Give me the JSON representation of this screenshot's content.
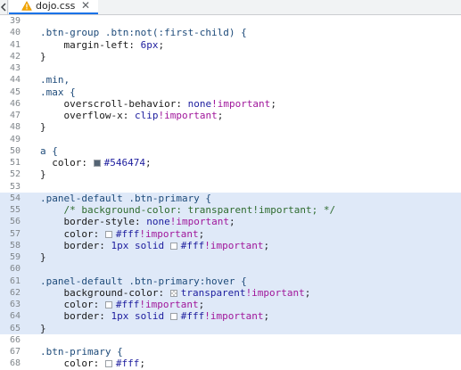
{
  "tab": {
    "file_name": "dojo.css",
    "close_glyph": "✕",
    "warning_icon": "warning-icon"
  },
  "colors": {
    "accent": "#1a73e8",
    "highlight": "#dfe9f8",
    "selector": "#1e4b7a",
    "value": "#1d1d9e",
    "important": "#a0179b",
    "comment": "#2e6b2e"
  },
  "lines": [
    {
      "n": "39",
      "hl": false,
      "tokens": []
    },
    {
      "n": "40",
      "hl": false,
      "tokens": [
        {
          "t": ".btn-group .btn:not(:first-child) {",
          "c": "sel"
        }
      ]
    },
    {
      "n": "41",
      "hl": false,
      "tokens": [
        {
          "t": "    margin-left: ",
          "c": "prop"
        },
        {
          "t": "6px",
          "c": "num"
        },
        {
          "t": ";",
          "c": "p"
        }
      ]
    },
    {
      "n": "42",
      "hl": false,
      "tokens": [
        {
          "t": "}",
          "c": "p"
        }
      ]
    },
    {
      "n": "43",
      "hl": false,
      "tokens": []
    },
    {
      "n": "44",
      "hl": false,
      "tokens": [
        {
          "t": ".min,",
          "c": "sel"
        }
      ]
    },
    {
      "n": "45",
      "hl": false,
      "tokens": [
        {
          "t": ".max {",
          "c": "sel"
        }
      ]
    },
    {
      "n": "46",
      "hl": false,
      "tokens": [
        {
          "t": "    overscroll-behavior: ",
          "c": "prop"
        },
        {
          "t": "none",
          "c": "val"
        },
        {
          "t": "!important",
          "c": "imp"
        },
        {
          "t": ";",
          "c": "p"
        }
      ]
    },
    {
      "n": "47",
      "hl": false,
      "tokens": [
        {
          "t": "    overflow-x: ",
          "c": "prop"
        },
        {
          "t": "clip",
          "c": "val"
        },
        {
          "t": "!important",
          "c": "imp"
        },
        {
          "t": ";",
          "c": "p"
        }
      ]
    },
    {
      "n": "48",
      "hl": false,
      "tokens": [
        {
          "t": "}",
          "c": "p"
        }
      ]
    },
    {
      "n": "49",
      "hl": false,
      "tokens": []
    },
    {
      "n": "50",
      "hl": false,
      "tokens": [
        {
          "t": "a {",
          "c": "sel"
        }
      ]
    },
    {
      "n": "51",
      "hl": false,
      "tokens": [
        {
          "t": "  color: ",
          "c": "prop"
        },
        {
          "sw": "#546474"
        },
        {
          "t": "#546474",
          "c": "val"
        },
        {
          "t": ";",
          "c": "p"
        }
      ]
    },
    {
      "n": "52",
      "hl": false,
      "tokens": [
        {
          "t": "}",
          "c": "p"
        }
      ]
    },
    {
      "n": "53",
      "hl": false,
      "tokens": []
    },
    {
      "n": "54",
      "hl": true,
      "tokens": [
        {
          "t": ".panel-default .btn-primary {",
          "c": "sel"
        }
      ]
    },
    {
      "n": "55",
      "hl": true,
      "tokens": [
        {
          "t": "    /* background-color: transparent!important; */",
          "c": "cmt"
        }
      ]
    },
    {
      "n": "56",
      "hl": true,
      "tokens": [
        {
          "t": "    border-style: ",
          "c": "prop"
        },
        {
          "t": "none",
          "c": "val"
        },
        {
          "t": "!important",
          "c": "imp"
        },
        {
          "t": ";",
          "c": "p"
        }
      ]
    },
    {
      "n": "57",
      "hl": true,
      "tokens": [
        {
          "t": "    color: ",
          "c": "prop"
        },
        {
          "sw": "#ffffff"
        },
        {
          "t": "#fff",
          "c": "val"
        },
        {
          "t": "!important",
          "c": "imp"
        },
        {
          "t": ";",
          "c": "p"
        }
      ]
    },
    {
      "n": "58",
      "hl": true,
      "tokens": [
        {
          "t": "    border: ",
          "c": "prop"
        },
        {
          "t": "1px",
          "c": "num"
        },
        {
          "t": " solid ",
          "c": "val"
        },
        {
          "sw": "#ffffff"
        },
        {
          "t": "#fff",
          "c": "val"
        },
        {
          "t": "!important",
          "c": "imp"
        },
        {
          "t": ";",
          "c": "p"
        }
      ]
    },
    {
      "n": "59",
      "hl": true,
      "tokens": [
        {
          "t": "}",
          "c": "p"
        }
      ]
    },
    {
      "n": "60",
      "hl": true,
      "tokens": []
    },
    {
      "n": "61",
      "hl": true,
      "tokens": [
        {
          "t": ".panel-default .btn-primary:hover {",
          "c": "sel"
        }
      ]
    },
    {
      "n": "62",
      "hl": true,
      "tokens": [
        {
          "t": "    background-color: ",
          "c": "prop"
        },
        {
          "sw": "checker"
        },
        {
          "t": "transparent",
          "c": "val"
        },
        {
          "t": "!important",
          "c": "imp"
        },
        {
          "t": ";",
          "c": "p"
        }
      ]
    },
    {
      "n": "63",
      "hl": true,
      "tokens": [
        {
          "t": "    color: ",
          "c": "prop"
        },
        {
          "sw": "#ffffff"
        },
        {
          "t": "#fff",
          "c": "val"
        },
        {
          "t": "!important",
          "c": "imp"
        },
        {
          "t": ";",
          "c": "p"
        }
      ]
    },
    {
      "n": "64",
      "hl": true,
      "tokens": [
        {
          "t": "    border: ",
          "c": "prop"
        },
        {
          "t": "1px",
          "c": "num"
        },
        {
          "t": " solid ",
          "c": "val"
        },
        {
          "sw": "#ffffff"
        },
        {
          "t": "#fff",
          "c": "val"
        },
        {
          "t": "!important",
          "c": "imp"
        },
        {
          "t": ";",
          "c": "p"
        }
      ]
    },
    {
      "n": "65",
      "hl": true,
      "tokens": [
        {
          "t": "}",
          "c": "p"
        }
      ]
    },
    {
      "n": "66",
      "hl": false,
      "tokens": []
    },
    {
      "n": "67",
      "hl": false,
      "tokens": [
        {
          "t": ".btn-primary {",
          "c": "sel"
        }
      ]
    },
    {
      "n": "68",
      "hl": false,
      "tokens": [
        {
          "t": "    color: ",
          "c": "prop"
        },
        {
          "sw": "#ffffff"
        },
        {
          "t": "#fff",
          "c": "val"
        },
        {
          "t": ";",
          "c": "p"
        }
      ]
    }
  ]
}
